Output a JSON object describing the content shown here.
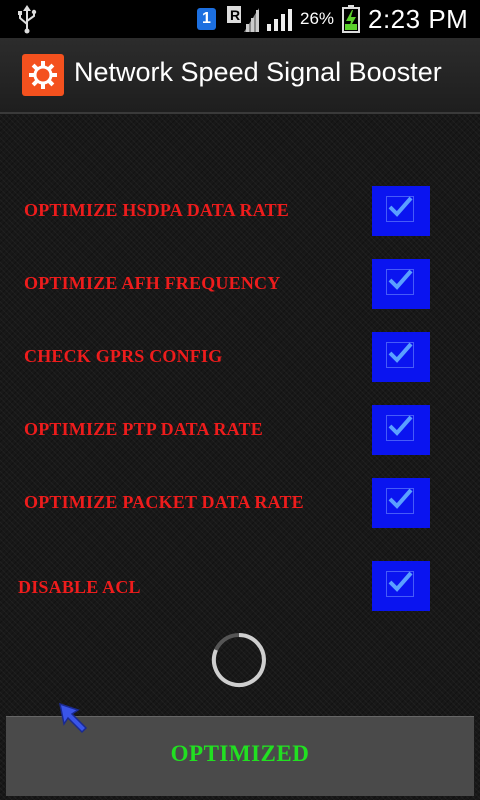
{
  "status_bar": {
    "notification_badge": "1",
    "roaming_letter": "R",
    "battery_percent": "26%",
    "time": "2:23 PM",
    "icons": [
      "usb-icon",
      "notification-icon",
      "roaming-icon",
      "signal-icon",
      "battery-charging-icon"
    ]
  },
  "app": {
    "title": "Network Speed Signal Booster",
    "icon": "gear-icon"
  },
  "options": [
    {
      "label": "OPTIMIZE HSDPA DATA RATE",
      "checked": true
    },
    {
      "label": "OPTIMIZE AFH FREQUENCY",
      "checked": true
    },
    {
      "label": "CHECK GPRS CONFIG",
      "checked": true
    },
    {
      "label": "OPTIMIZE PTP DATA RATE",
      "checked": true
    },
    {
      "label": "OPTIMIZE PACKET DATA RATE",
      "checked": true
    },
    {
      "label": "DISABLE ACL",
      "checked": true
    }
  ],
  "action_button": {
    "label": "OPTIMIZED"
  },
  "colors": {
    "option_label": "#ee1c1c",
    "checkbox": "#0a14f0",
    "button_label": "#21e021",
    "app_icon": "#f4511e"
  }
}
